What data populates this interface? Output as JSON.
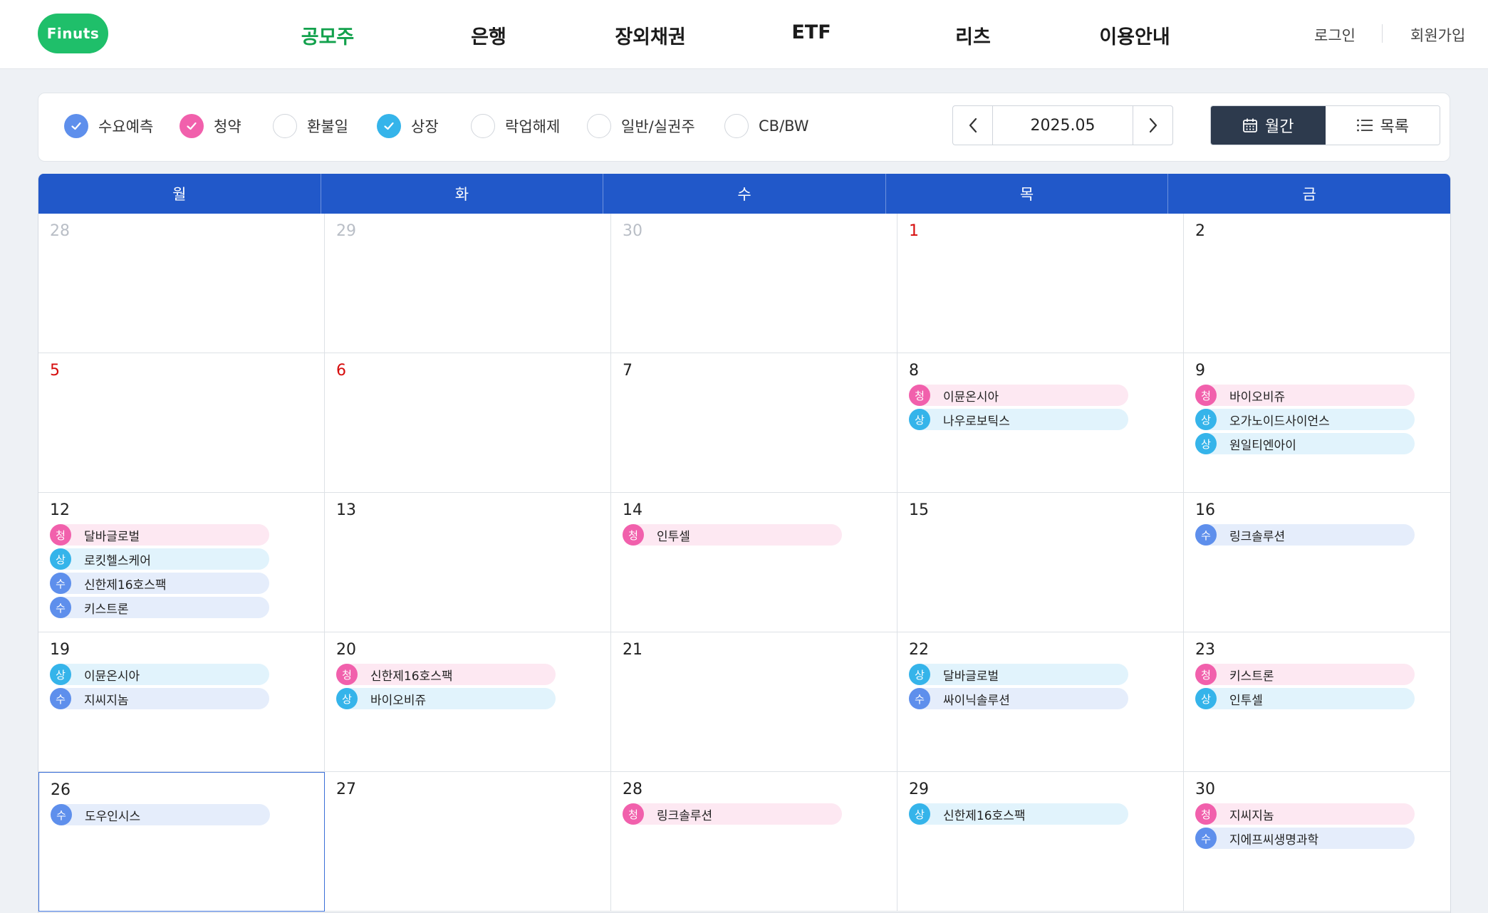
{
  "colors": {
    "brand": "#1fbf6a",
    "nav_active": "#12a14c",
    "calendar_header": "#2158c9",
    "holiday": "#d60c0c",
    "subscribe": "#f160ac",
    "listing": "#35b4ea",
    "demand": "#5e8fec"
  },
  "header": {
    "logo": "Finuts",
    "nav": [
      "공모주",
      "은행",
      "장외채권",
      "ETF",
      "리츠",
      "이용안내"
    ],
    "active_nav": "공모주",
    "login": "로그인",
    "signup": "회원가입"
  },
  "filters": [
    {
      "label": "수요예측",
      "checked": true,
      "color": "#5e8fec"
    },
    {
      "label": "청약",
      "checked": true,
      "color": "#f160ac"
    },
    {
      "label": "환불일",
      "checked": false,
      "color": ""
    },
    {
      "label": "상장",
      "checked": true,
      "color": "#35b4ea"
    },
    {
      "label": "락업해제",
      "checked": false,
      "color": ""
    },
    {
      "label": "일반/실권주",
      "checked": false,
      "color": ""
    },
    {
      "label": "CB/BW",
      "checked": false,
      "color": ""
    }
  ],
  "month": "2025.05",
  "view": {
    "monthly": "월간",
    "list": "목록",
    "active": "monthly"
  },
  "weekdays": [
    "월",
    "화",
    "수",
    "목",
    "금"
  ],
  "weeks": [
    [
      {
        "date": "28",
        "muted": true,
        "events": []
      },
      {
        "date": "29",
        "muted": true,
        "events": []
      },
      {
        "date": "30",
        "muted": true,
        "events": []
      },
      {
        "date": "1",
        "holiday": true,
        "events": []
      },
      {
        "date": "2",
        "events": []
      }
    ],
    [
      {
        "date": "5",
        "holiday": true,
        "events": []
      },
      {
        "date": "6",
        "holiday": true,
        "events": []
      },
      {
        "date": "7",
        "events": []
      },
      {
        "date": "8",
        "events": [
          {
            "type": "청",
            "name": "이뮨온시아"
          },
          {
            "type": "상",
            "name": "나우로보틱스"
          }
        ]
      },
      {
        "date": "9",
        "events": [
          {
            "type": "청",
            "name": "바이오비쥬"
          },
          {
            "type": "상",
            "name": "오가노이드사이언스"
          },
          {
            "type": "상",
            "name": "원일티엔아이"
          }
        ]
      }
    ],
    [
      {
        "date": "12",
        "events": [
          {
            "type": "청",
            "name": "달바글로벌"
          },
          {
            "type": "상",
            "name": "로킷헬스케어"
          },
          {
            "type": "수",
            "name": "신한제16호스팩"
          },
          {
            "type": "수",
            "name": "키스트론"
          }
        ]
      },
      {
        "date": "13",
        "events": []
      },
      {
        "date": "14",
        "events": [
          {
            "type": "청",
            "name": "인투셀"
          }
        ]
      },
      {
        "date": "15",
        "events": []
      },
      {
        "date": "16",
        "events": [
          {
            "type": "수",
            "name": "링크솔루션"
          }
        ]
      }
    ],
    [
      {
        "date": "19",
        "events": [
          {
            "type": "상",
            "name": "이뮨온시아"
          },
          {
            "type": "수",
            "name": "지씨지놈"
          }
        ]
      },
      {
        "date": "20",
        "events": [
          {
            "type": "청",
            "name": "신한제16호스팩"
          },
          {
            "type": "상",
            "name": "바이오비쥬"
          }
        ]
      },
      {
        "date": "21",
        "events": []
      },
      {
        "date": "22",
        "events": [
          {
            "type": "상",
            "name": "달바글로벌"
          },
          {
            "type": "수",
            "name": "싸이닉솔루션"
          }
        ]
      },
      {
        "date": "23",
        "events": [
          {
            "type": "청",
            "name": "키스트론"
          },
          {
            "type": "상",
            "name": "인투셀"
          }
        ]
      }
    ],
    [
      {
        "date": "26",
        "today": true,
        "events": [
          {
            "type": "수",
            "name": "도우인시스"
          }
        ]
      },
      {
        "date": "27",
        "events": []
      },
      {
        "date": "28",
        "events": [
          {
            "type": "청",
            "name": "링크솔루션"
          }
        ]
      },
      {
        "date": "29",
        "events": [
          {
            "type": "상",
            "name": "신한제16호스팩"
          }
        ]
      },
      {
        "date": "30",
        "events": [
          {
            "type": "청",
            "name": "지씨지놈"
          },
          {
            "type": "수",
            "name": "지에프씨생명과학"
          }
        ]
      }
    ]
  ]
}
